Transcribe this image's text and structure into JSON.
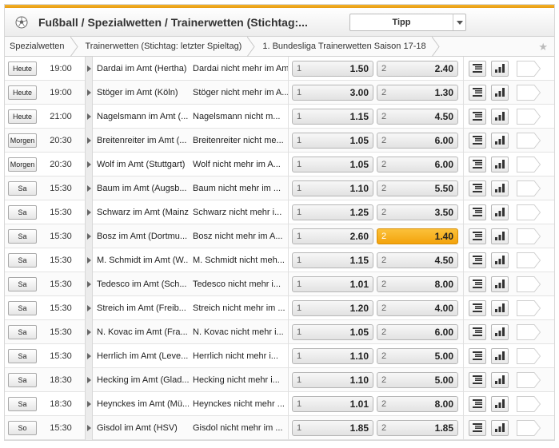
{
  "header": {
    "title": "Fußball / Spezialwetten / Trainerwetten (Stichtag:...",
    "dropdown_label": "Tipp"
  },
  "breadcrumb": [
    "Spezialwetten",
    "Trainerwetten (Stichtag: letzter Spieltag)",
    "1. Bundesliga Trainerwetten Saison 17-18"
  ],
  "odds_labels": {
    "tip1": "1",
    "tip2": "2"
  },
  "rows": [
    {
      "day": "Heute",
      "time": "19:00",
      "a": "Dardai im Amt (Hertha)",
      "b": "Dardai nicht mehr im Amt",
      "q1": "1.50",
      "q2": "2.40",
      "selected": ""
    },
    {
      "day": "Heute",
      "time": "19:00",
      "a": "Stöger im Amt (Köln)",
      "b": "Stöger nicht mehr im A...",
      "q1": "3.00",
      "q2": "1.30",
      "selected": ""
    },
    {
      "day": "Heute",
      "time": "21:00",
      "a": "Nagelsmann im Amt (...",
      "b": "Nagelsmann nicht m...",
      "q1": "1.15",
      "q2": "4.50",
      "selected": ""
    },
    {
      "day": "Morgen",
      "time": "20:30",
      "a": "Breitenreiter im Amt (...",
      "b": "Breitenreiter nicht me...",
      "q1": "1.05",
      "q2": "6.00",
      "selected": ""
    },
    {
      "day": "Morgen",
      "time": "20:30",
      "a": "Wolf im Amt (Stuttgart)",
      "b": "Wolf nicht mehr im A...",
      "q1": "1.05",
      "q2": "6.00",
      "selected": ""
    },
    {
      "day": "Sa",
      "time": "15:30",
      "a": "Baum im Amt (Augsb...",
      "b": "Baum nicht mehr im ...",
      "q1": "1.10",
      "q2": "5.50",
      "selected": ""
    },
    {
      "day": "Sa",
      "time": "15:30",
      "a": "Schwarz im Amt (Mainz)",
      "b": "Schwarz nicht mehr i...",
      "q1": "1.25",
      "q2": "3.50",
      "selected": ""
    },
    {
      "day": "Sa",
      "time": "15:30",
      "a": "Bosz im Amt (Dortmu...",
      "b": "Bosz nicht mehr im A...",
      "q1": "2.60",
      "q2": "1.40",
      "selected": "2"
    },
    {
      "day": "Sa",
      "time": "15:30",
      "a": "M. Schmidt im Amt (W...",
      "b": "M. Schmidt nicht meh...",
      "q1": "1.15",
      "q2": "4.50",
      "selected": ""
    },
    {
      "day": "Sa",
      "time": "15:30",
      "a": "Tedesco im Amt (Sch...",
      "b": "Tedesco nicht mehr i...",
      "q1": "1.01",
      "q2": "8.00",
      "selected": ""
    },
    {
      "day": "Sa",
      "time": "15:30",
      "a": "Streich im Amt (Freib...",
      "b": "Streich nicht mehr im ...",
      "q1": "1.20",
      "q2": "4.00",
      "selected": ""
    },
    {
      "day": "Sa",
      "time": "15:30",
      "a": "N. Kovac im Amt (Fra...",
      "b": "N. Kovac nicht mehr i...",
      "q1": "1.05",
      "q2": "6.00",
      "selected": ""
    },
    {
      "day": "Sa",
      "time": "15:30",
      "a": "Herrlich im Amt (Leve...",
      "b": "Herrlich nicht mehr i...",
      "q1": "1.10",
      "q2": "5.00",
      "selected": ""
    },
    {
      "day": "Sa",
      "time": "18:30",
      "a": "Hecking im Amt (Glad...",
      "b": "Hecking nicht mehr i...",
      "q1": "1.10",
      "q2": "5.00",
      "selected": ""
    },
    {
      "day": "Sa",
      "time": "18:30",
      "a": "Heynckes im Amt (Mü...",
      "b": "Heynckes nicht mehr ...",
      "q1": "1.01",
      "q2": "8.00",
      "selected": ""
    },
    {
      "day": "So",
      "time": "15:30",
      "a": "Gisdol im Amt (HSV)",
      "b": "Gisdol nicht mehr im ...",
      "q1": "1.85",
      "q2": "1.85",
      "selected": ""
    }
  ],
  "colors": {
    "accent": "#f3a30c",
    "topbar": "#e79b12"
  },
  "icons": {
    "header": "soccer-ball-icon",
    "dropdown": "chevron-down-icon",
    "favorite": "star-icon",
    "row_expand": "triangle-right-icon",
    "row_list": "list-icon",
    "row_stats": "bar-chart-icon"
  }
}
